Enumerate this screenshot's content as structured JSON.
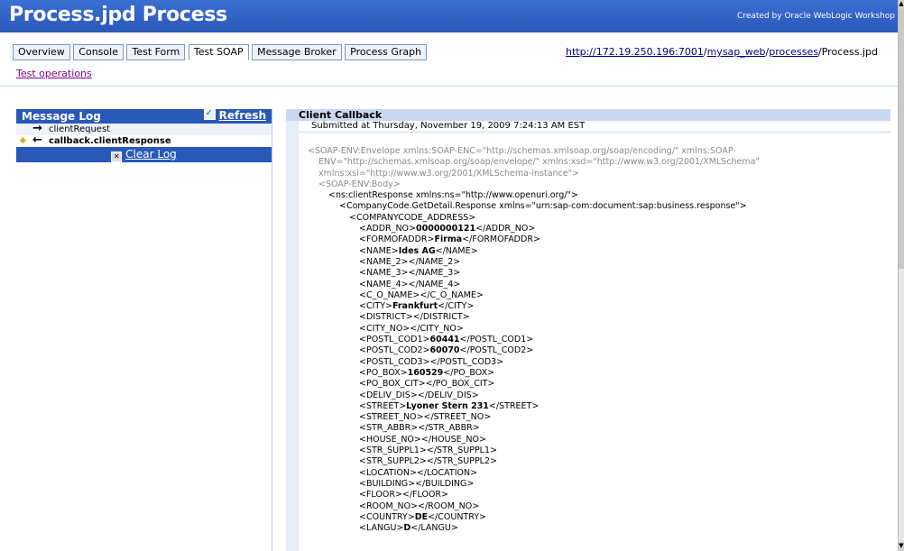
{
  "header": {
    "title": "Process.jpd Process",
    "credit": "Created by Oracle WebLogic Workshop"
  },
  "tabs": [
    {
      "label": "Overview"
    },
    {
      "label": "Console"
    },
    {
      "label": "Test Form"
    },
    {
      "label": "Test SOAP"
    },
    {
      "label": "Message Broker"
    },
    {
      "label": "Process Graph"
    }
  ],
  "url": {
    "host": "http://172.19.250.196:7001",
    "sep1": "/",
    "app": "mysap_web",
    "sep2": "/",
    "folder": "processes",
    "file": "/Process.jpd"
  },
  "test_operations": "Test operations",
  "message_log": {
    "title": "Message Log",
    "refresh": "Refresh",
    "items": [
      {
        "label": "clientRequest"
      },
      {
        "label": "callback.clientResponse"
      }
    ],
    "clear": "Clear Log"
  },
  "callback": {
    "title": "Client Callback",
    "submitted": "Submitted at Thursday, November 19, 2009 7:24:13 AM EST"
  },
  "xml_lines": [
    {
      "indent": 0,
      "cls": "g",
      "pre": "<SOAP-ENV:Envelope xmlns:SOAP-ENC=\"http://schemas.xmlsoap.org/soap/encoding/\" xmlns:SOAP-",
      "val": "",
      "post": ""
    },
    {
      "indent": 1,
      "cls": "g",
      "pre": "ENV=\"http://schemas.xmlsoap.org/soap/envelope/\" xmlns:xsd=\"http://www.w3.org/2001/XMLSchema\"",
      "val": "",
      "post": ""
    },
    {
      "indent": 1,
      "cls": "g",
      "pre": "xmlns:xsi=\"http://www.w3.org/2001/XMLSchema-instance\">",
      "val": "",
      "post": ""
    },
    {
      "indent": 1,
      "cls": "g",
      "pre": "<SOAP-ENV:Body>",
      "val": "",
      "post": ""
    },
    {
      "indent": 2,
      "cls": "",
      "pre": "<ns:clientResponse xmlns:ns=\"http://www.openuri.org/\">",
      "val": "",
      "post": ""
    },
    {
      "indent": 3,
      "cls": "",
      "pre": "<CompanyCode.GetDetail.Response xmlns=\"urn:sap-com:document:sap:business.response\">",
      "val": "",
      "post": ""
    },
    {
      "indent": 4,
      "cls": "",
      "pre": "<COMPANYCODE_ADDRESS>",
      "val": "",
      "post": ""
    },
    {
      "indent": 5,
      "cls": "",
      "pre": "<ADDR_NO>",
      "val": "0000000121",
      "post": "</ADDR_NO>"
    },
    {
      "indent": 5,
      "cls": "",
      "pre": "<FORMOFADDR>",
      "val": "Firma",
      "post": "</FORMOFADDR>"
    },
    {
      "indent": 5,
      "cls": "",
      "pre": "<NAME>",
      "val": "Ides AG",
      "post": "</NAME>"
    },
    {
      "indent": 5,
      "cls": "",
      "pre": "<NAME_2></NAME_2>",
      "val": "",
      "post": ""
    },
    {
      "indent": 5,
      "cls": "",
      "pre": "<NAME_3></NAME_3>",
      "val": "",
      "post": ""
    },
    {
      "indent": 5,
      "cls": "",
      "pre": "<NAME_4></NAME_4>",
      "val": "",
      "post": ""
    },
    {
      "indent": 5,
      "cls": "",
      "pre": "<C_O_NAME></C_O_NAME>",
      "val": "",
      "post": ""
    },
    {
      "indent": 5,
      "cls": "",
      "pre": "<CITY>",
      "val": "Frankfurt",
      "post": "</CITY>"
    },
    {
      "indent": 5,
      "cls": "",
      "pre": "<DISTRICT></DISTRICT>",
      "val": "",
      "post": ""
    },
    {
      "indent": 5,
      "cls": "",
      "pre": "<CITY_NO></CITY_NO>",
      "val": "",
      "post": ""
    },
    {
      "indent": 5,
      "cls": "",
      "pre": "<POSTL_COD1>",
      "val": "60441",
      "post": "</POSTL_COD1>"
    },
    {
      "indent": 5,
      "cls": "",
      "pre": "<POSTL_COD2>",
      "val": "60070",
      "post": "</POSTL_COD2>"
    },
    {
      "indent": 5,
      "cls": "",
      "pre": "<POSTL_COD3></POSTL_COD3>",
      "val": "",
      "post": ""
    },
    {
      "indent": 5,
      "cls": "",
      "pre": "<PO_BOX>",
      "val": "160529",
      "post": "</PO_BOX>"
    },
    {
      "indent": 5,
      "cls": "",
      "pre": "<PO_BOX_CIT></PO_BOX_CIT>",
      "val": "",
      "post": ""
    },
    {
      "indent": 5,
      "cls": "",
      "pre": "<DELIV_DIS></DELIV_DIS>",
      "val": "",
      "post": ""
    },
    {
      "indent": 5,
      "cls": "",
      "pre": "<STREET>",
      "val": "Lyoner Stern 231",
      "post": "</STREET>"
    },
    {
      "indent": 5,
      "cls": "",
      "pre": "<STREET_NO></STREET_NO>",
      "val": "",
      "post": ""
    },
    {
      "indent": 5,
      "cls": "",
      "pre": "<STR_ABBR></STR_ABBR>",
      "val": "",
      "post": ""
    },
    {
      "indent": 5,
      "cls": "",
      "pre": "<HOUSE_NO></HOUSE_NO>",
      "val": "",
      "post": ""
    },
    {
      "indent": 5,
      "cls": "",
      "pre": "<STR_SUPPL1></STR_SUPPL1>",
      "val": "",
      "post": ""
    },
    {
      "indent": 5,
      "cls": "",
      "pre": "<STR_SUPPL2></STR_SUPPL2>",
      "val": "",
      "post": ""
    },
    {
      "indent": 5,
      "cls": "",
      "pre": "<LOCATION></LOCATION>",
      "val": "",
      "post": ""
    },
    {
      "indent": 5,
      "cls": "",
      "pre": "<BUILDING></BUILDING>",
      "val": "",
      "post": ""
    },
    {
      "indent": 5,
      "cls": "",
      "pre": "<FLOOR></FLOOR>",
      "val": "",
      "post": ""
    },
    {
      "indent": 5,
      "cls": "",
      "pre": "<ROOM_NO></ROOM_NO>",
      "val": "",
      "post": ""
    },
    {
      "indent": 5,
      "cls": "",
      "pre": "<COUNTRY>",
      "val": "DE",
      "post": "</COUNTRY>"
    },
    {
      "indent": 5,
      "cls": "",
      "pre": "<LANGU>",
      "val": "D",
      "post": "</LANGU>"
    }
  ]
}
